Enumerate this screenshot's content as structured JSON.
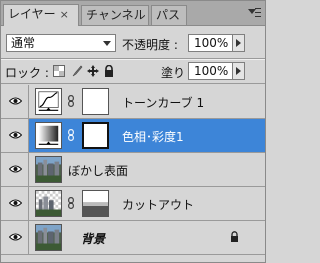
{
  "tabs": [
    {
      "label": "レイヤー",
      "close": "×"
    },
    {
      "label": "チャンネル"
    },
    {
      "label": "パス"
    }
  ],
  "menu_icon": "panel-menu-icon",
  "blend_mode": "通常",
  "opacity": {
    "label": "不透明度 :",
    "value": "100%"
  },
  "lock": {
    "label": "ロック :"
  },
  "fill": {
    "label": "塗り :",
    "value": "100%"
  },
  "layers": [
    {
      "name": "トーンカーブ 1",
      "type": "adjustment-curves"
    },
    {
      "name": "色相･彩度1",
      "type": "adjustment-hue",
      "selected": true
    },
    {
      "name": "ぼかし表面",
      "type": "image"
    },
    {
      "name": "カットアウト",
      "type": "image-mask"
    },
    {
      "name": "背景",
      "type": "background",
      "locked": true
    }
  ],
  "colors": {
    "selection": "#3d85d8",
    "panel": "#d6d6d6"
  }
}
